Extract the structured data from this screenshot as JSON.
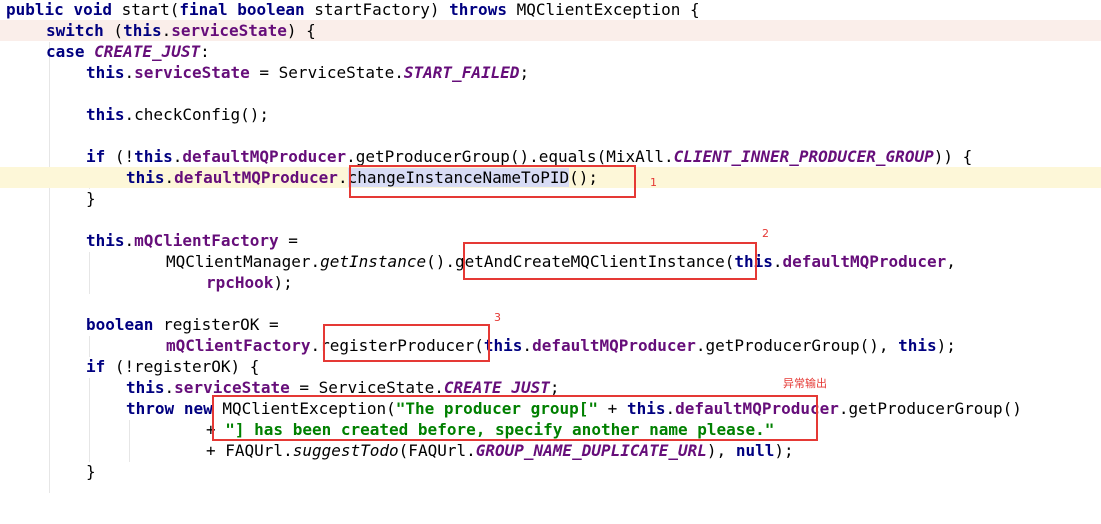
{
  "editor": {
    "lines": {
      "l01": {
        "t1": "public",
        "t2": " ",
        "t3": "void",
        "t4": " start(",
        "t5": "final",
        "t6": " ",
        "t7": "boolean",
        "t8": " startFactory) ",
        "t9": "throws",
        "t10": " MQClientException {"
      },
      "l02": {
        "t1": "switch",
        "t2": " (",
        "t3": "this",
        "t4": ".",
        "t5": "serviceState",
        "t6": ") {"
      },
      "l03": {
        "t1": "case",
        "t2": " ",
        "t3": "CREATE_JUST",
        "t4": ":"
      },
      "l04": {
        "t1": "this",
        "t2": ".",
        "t3": "serviceState",
        "t4": " = ServiceState.",
        "t5": "START_FAILED",
        "t6": ";"
      },
      "l05": {
        "t1": "this",
        "t2": ".checkConfig();"
      },
      "l06": {
        "t1": "if",
        "t2": " (!",
        "t3": "this",
        "t4": ".",
        "t5": "defaultMQProducer",
        "t6": ".getProducerGroup().equals(MixAll.",
        "t7": "CLIENT_INNER_PRODUCER_GROUP",
        "t8": ")) {"
      },
      "l07": {
        "t1": "this",
        "t2": ".",
        "t3": "defaultMQProducer",
        "t4": ".",
        "t5": "changeInstanceNameToPID",
        "t6": "();"
      },
      "l08": {
        "t1": "}"
      },
      "l09": {
        "t1": "this",
        "t2": ".",
        "t3": "mQClientFactory",
        "t4": " ="
      },
      "l10": {
        "t1": "MQClientManager.",
        "t2": "getInstance",
        "t3": "().getAndCreateMQClientInstance(",
        "t4": "this",
        "t5": ".",
        "t6": "defaultMQProducer",
        "t7": ","
      },
      "l11": {
        "t1": "rpcHook",
        "t2": ");"
      },
      "l12": {
        "t1": "boolean",
        "t2": " registerOK ="
      },
      "l13": {
        "t1": "mQClientFactory",
        "t2": ".registerProducer(",
        "t3": "this",
        "t4": ".",
        "t5": "defaultMQProducer",
        "t6": ".getProducerGroup(), ",
        "t7": "this",
        "t8": ");"
      },
      "l14": {
        "t1": "if",
        "t2": " (!registerOK) {"
      },
      "l15": {
        "t1": "this",
        "t2": ".",
        "t3": "serviceState",
        "t4": " = ServiceState.",
        "t5": "CREATE_JUST",
        "t6": ";"
      },
      "l16": {
        "t1": "throw",
        "t2": " ",
        "t3": "new",
        "t4": " MQClientException(",
        "t5": "\"The producer group[\"",
        "t6": " + ",
        "t7": "this",
        "t8": ".",
        "t9": "defaultMQProducer",
        "t10": ".getProducerGroup()"
      },
      "l17": {
        "t1": "+ ",
        "t2": "\"] has been created before, specify another name please.\""
      },
      "l18": {
        "t1": "+ FAQUrl.",
        "t2": "suggestTodo",
        "t3": "(FAQUrl.",
        "t4": "GROUP_NAME_DUPLICATE_URL",
        "t5": "), ",
        "t6": "null",
        "t7": ");"
      },
      "l19": {
        "t1": "}"
      }
    }
  },
  "annotations": {
    "a1": "1",
    "a2": "2",
    "a3": "3",
    "a4": "异常输出"
  },
  "colors": {
    "keyword": "#000080",
    "field": "#660e7a",
    "string": "#008000",
    "annotation_box": "#e53935",
    "current_line": "#fdf7d8",
    "highlight_line": "#faeeea",
    "selection": "#d8dcf5"
  }
}
